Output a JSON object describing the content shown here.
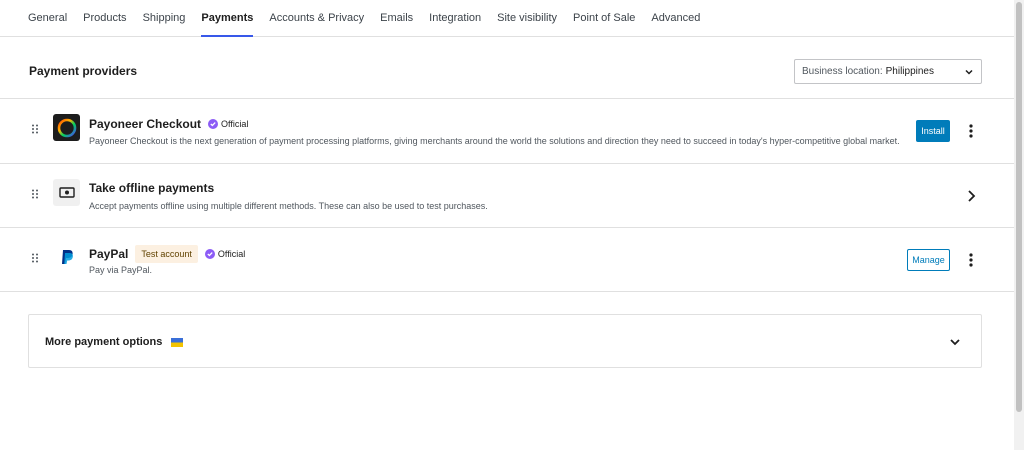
{
  "tabs": [
    {
      "label": "General",
      "active": false
    },
    {
      "label": "Products",
      "active": false
    },
    {
      "label": "Shipping",
      "active": false
    },
    {
      "label": "Payments",
      "active": true
    },
    {
      "label": "Accounts & Privacy",
      "active": false
    },
    {
      "label": "Emails",
      "active": false
    },
    {
      "label": "Integration",
      "active": false
    },
    {
      "label": "Site visibility",
      "active": false
    },
    {
      "label": "Point of Sale",
      "active": false
    },
    {
      "label": "Advanced",
      "active": false
    }
  ],
  "header": {
    "title": "Payment providers",
    "location_label": "Business location:",
    "location_value": "Philippines"
  },
  "providers": [
    {
      "name": "Payoneer Checkout",
      "official_label": "Official",
      "description": "Payoneer Checkout is the next generation of payment processing platforms, giving merchants around the world the solutions and direction they need to succeed in today's hyper-competitive global market.",
      "action_label": "Install",
      "logo_icon": "payoneer-logo-icon"
    },
    {
      "name": "Take offline payments",
      "description": "Accept payments offline using multiple different methods. These can also be used to test purchases.",
      "logo_icon": "cash-icon"
    },
    {
      "name": "PayPal",
      "badge_label": "Test account",
      "official_label": "Official",
      "description": "Pay via PayPal.",
      "action_label": "Manage",
      "logo_icon": "paypal-logo-icon"
    }
  ],
  "more_options": {
    "label": "More payment options",
    "flag_icon": "ukraine-flag-icon"
  },
  "colors": {
    "accent": "#007cba",
    "tab_indicator": "#3858e9",
    "official_purple": "#8c5cf6",
    "badge_bg": "#fcf0e1"
  }
}
